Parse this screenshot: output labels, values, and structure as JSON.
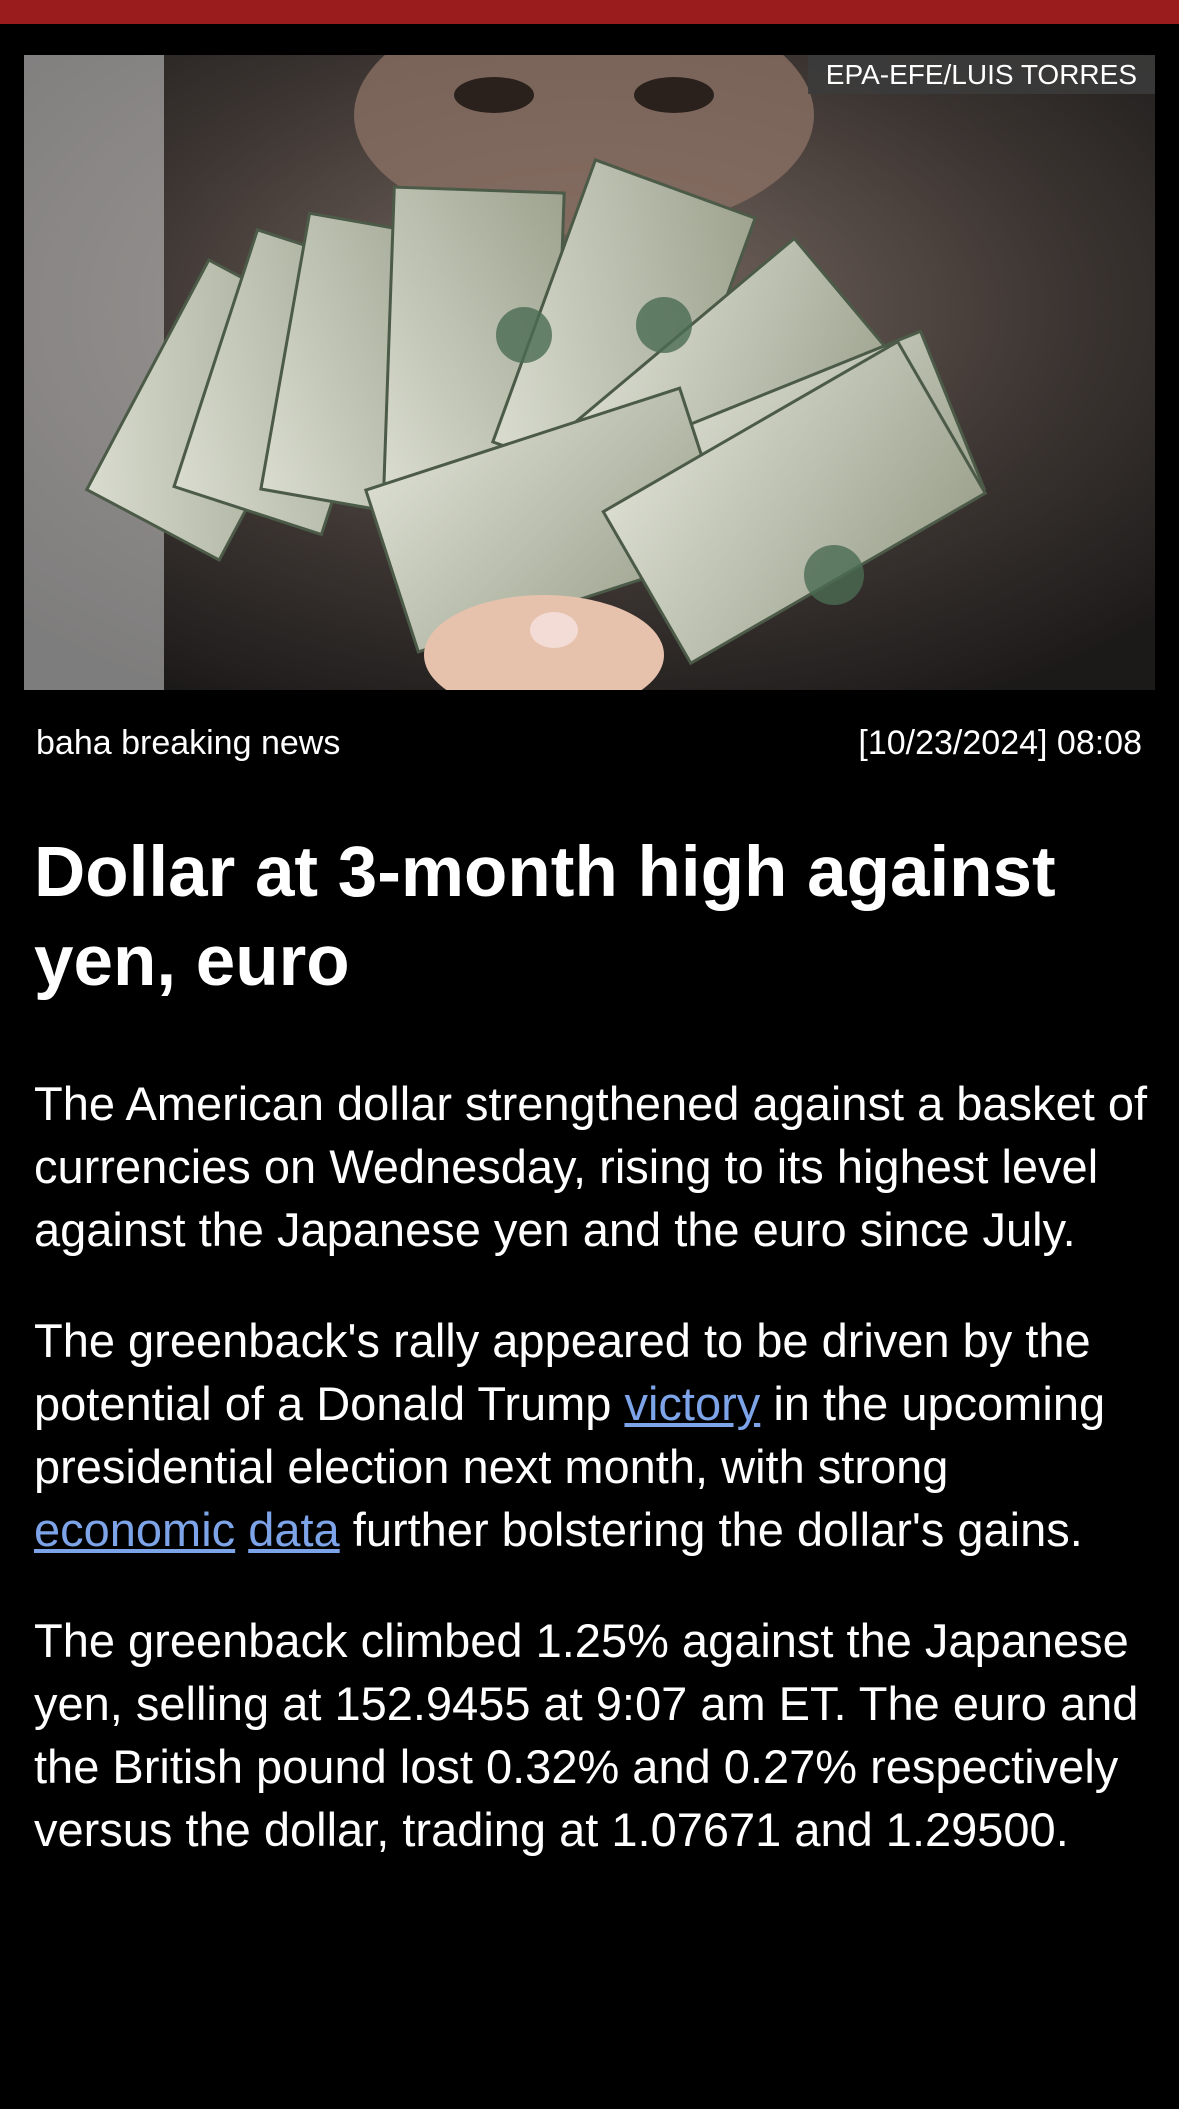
{
  "colors": {
    "top_bar": "#9b1c1c",
    "background": "#000000",
    "text": "#ffffff",
    "link": "#7da4e8"
  },
  "hero": {
    "image_name": "woman-holding-dollar-bills-photo",
    "credit": "EPA-EFE/LUIS TORRES"
  },
  "meta": {
    "source": "baha breaking news",
    "datetime": "[10/23/2024] 08:08"
  },
  "headline": "Dollar at 3-month high against yen, euro",
  "article": {
    "p1": "The American dollar strengthened against a basket of currencies on Wednesday, rising to its highest level against the Japanese yen and the euro since July.",
    "p2_a": "The greenback's rally appeared to be driven by the potential of a Donald Trump ",
    "p2_link1": "victory",
    "p2_b": " in the upcoming presidential election next month, with strong ",
    "p2_link2": "economic",
    "p2_c": " ",
    "p2_link3": "data",
    "p2_d": " further bolstering the dollar's gains.",
    "p3": "The greenback climbed 1.25% against the Japanese yen, selling at 152.9455 at 9:07 am ET. The euro and the British pound lost 0.32% and 0.27% respectively versus the dollar, trading at 1.07671 and 1.29500."
  }
}
